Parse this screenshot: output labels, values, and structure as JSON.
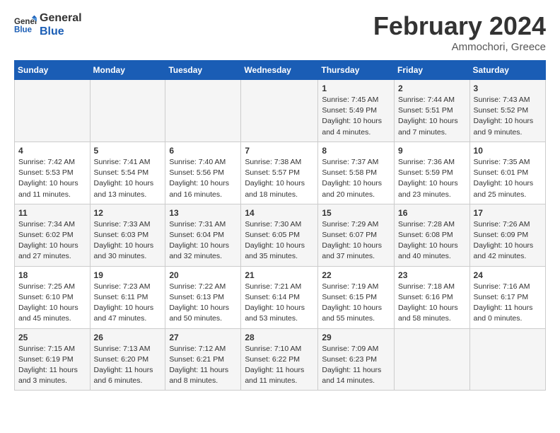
{
  "logo": {
    "line1": "General",
    "line2": "Blue"
  },
  "title": "February 2024",
  "subtitle": "Ammochori, Greece",
  "days_of_week": [
    "Sunday",
    "Monday",
    "Tuesday",
    "Wednesday",
    "Thursday",
    "Friday",
    "Saturday"
  ],
  "weeks": [
    [
      {
        "num": "",
        "detail": ""
      },
      {
        "num": "",
        "detail": ""
      },
      {
        "num": "",
        "detail": ""
      },
      {
        "num": "",
        "detail": ""
      },
      {
        "num": "1",
        "detail": "Sunrise: 7:45 AM\nSunset: 5:49 PM\nDaylight: 10 hours\nand 4 minutes."
      },
      {
        "num": "2",
        "detail": "Sunrise: 7:44 AM\nSunset: 5:51 PM\nDaylight: 10 hours\nand 7 minutes."
      },
      {
        "num": "3",
        "detail": "Sunrise: 7:43 AM\nSunset: 5:52 PM\nDaylight: 10 hours\nand 9 minutes."
      }
    ],
    [
      {
        "num": "4",
        "detail": "Sunrise: 7:42 AM\nSunset: 5:53 PM\nDaylight: 10 hours\nand 11 minutes."
      },
      {
        "num": "5",
        "detail": "Sunrise: 7:41 AM\nSunset: 5:54 PM\nDaylight: 10 hours\nand 13 minutes."
      },
      {
        "num": "6",
        "detail": "Sunrise: 7:40 AM\nSunset: 5:56 PM\nDaylight: 10 hours\nand 16 minutes."
      },
      {
        "num": "7",
        "detail": "Sunrise: 7:38 AM\nSunset: 5:57 PM\nDaylight: 10 hours\nand 18 minutes."
      },
      {
        "num": "8",
        "detail": "Sunrise: 7:37 AM\nSunset: 5:58 PM\nDaylight: 10 hours\nand 20 minutes."
      },
      {
        "num": "9",
        "detail": "Sunrise: 7:36 AM\nSunset: 5:59 PM\nDaylight: 10 hours\nand 23 minutes."
      },
      {
        "num": "10",
        "detail": "Sunrise: 7:35 AM\nSunset: 6:01 PM\nDaylight: 10 hours\nand 25 minutes."
      }
    ],
    [
      {
        "num": "11",
        "detail": "Sunrise: 7:34 AM\nSunset: 6:02 PM\nDaylight: 10 hours\nand 27 minutes."
      },
      {
        "num": "12",
        "detail": "Sunrise: 7:33 AM\nSunset: 6:03 PM\nDaylight: 10 hours\nand 30 minutes."
      },
      {
        "num": "13",
        "detail": "Sunrise: 7:31 AM\nSunset: 6:04 PM\nDaylight: 10 hours\nand 32 minutes."
      },
      {
        "num": "14",
        "detail": "Sunrise: 7:30 AM\nSunset: 6:05 PM\nDaylight: 10 hours\nand 35 minutes."
      },
      {
        "num": "15",
        "detail": "Sunrise: 7:29 AM\nSunset: 6:07 PM\nDaylight: 10 hours\nand 37 minutes."
      },
      {
        "num": "16",
        "detail": "Sunrise: 7:28 AM\nSunset: 6:08 PM\nDaylight: 10 hours\nand 40 minutes."
      },
      {
        "num": "17",
        "detail": "Sunrise: 7:26 AM\nSunset: 6:09 PM\nDaylight: 10 hours\nand 42 minutes."
      }
    ],
    [
      {
        "num": "18",
        "detail": "Sunrise: 7:25 AM\nSunset: 6:10 PM\nDaylight: 10 hours\nand 45 minutes."
      },
      {
        "num": "19",
        "detail": "Sunrise: 7:23 AM\nSunset: 6:11 PM\nDaylight: 10 hours\nand 47 minutes."
      },
      {
        "num": "20",
        "detail": "Sunrise: 7:22 AM\nSunset: 6:13 PM\nDaylight: 10 hours\nand 50 minutes."
      },
      {
        "num": "21",
        "detail": "Sunrise: 7:21 AM\nSunset: 6:14 PM\nDaylight: 10 hours\nand 53 minutes."
      },
      {
        "num": "22",
        "detail": "Sunrise: 7:19 AM\nSunset: 6:15 PM\nDaylight: 10 hours\nand 55 minutes."
      },
      {
        "num": "23",
        "detail": "Sunrise: 7:18 AM\nSunset: 6:16 PM\nDaylight: 10 hours\nand 58 minutes."
      },
      {
        "num": "24",
        "detail": "Sunrise: 7:16 AM\nSunset: 6:17 PM\nDaylight: 11 hours\nand 0 minutes."
      }
    ],
    [
      {
        "num": "25",
        "detail": "Sunrise: 7:15 AM\nSunset: 6:19 PM\nDaylight: 11 hours\nand 3 minutes."
      },
      {
        "num": "26",
        "detail": "Sunrise: 7:13 AM\nSunset: 6:20 PM\nDaylight: 11 hours\nand 6 minutes."
      },
      {
        "num": "27",
        "detail": "Sunrise: 7:12 AM\nSunset: 6:21 PM\nDaylight: 11 hours\nand 8 minutes."
      },
      {
        "num": "28",
        "detail": "Sunrise: 7:10 AM\nSunset: 6:22 PM\nDaylight: 11 hours\nand 11 minutes."
      },
      {
        "num": "29",
        "detail": "Sunrise: 7:09 AM\nSunset: 6:23 PM\nDaylight: 11 hours\nand 14 minutes."
      },
      {
        "num": "",
        "detail": ""
      },
      {
        "num": "",
        "detail": ""
      }
    ]
  ]
}
